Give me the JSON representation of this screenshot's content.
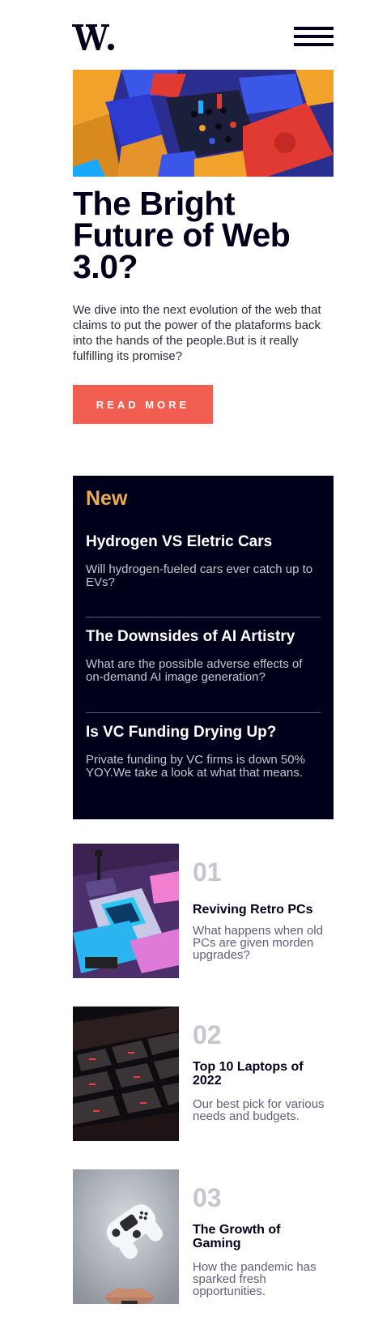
{
  "header": {
    "logo_icon": "w-logo-icon",
    "menu_icon": "hamburger-menu-icon"
  },
  "hero": {
    "image_icon": "abstract-3d-blocks-image",
    "title": "The Bright Future of Web 3.0?",
    "description": "We dive into the next evolution of the web that claims to put the power of the plataforms back into the hands of the people.But is it really fulfilling its promise?",
    "button_label": "READ MORE",
    "button_color": "#f15e50"
  },
  "new_section": {
    "heading": "New",
    "heading_color": "#e9ab53",
    "background": "#00001a",
    "items": [
      {
        "title": "Hydrogen VS Eletric Cars",
        "description": "Will hydrogen-fueled cars ever catch up to EVs?"
      },
      {
        "title": "The Downsides of AI Artistry",
        "description": "What are the possible adverse effects of on-demand AI image generation?"
      },
      {
        "title": "Is VC Funding Drying Up?",
        "description": "Private funding by VC firms is down 50% YOY.We take a look at what that means."
      }
    ]
  },
  "cards": [
    {
      "number": "01",
      "title": "Reviving Retro PCs",
      "description": "What happens when old PCs are given morden upgrades?",
      "image_icon": "retro-pc-image"
    },
    {
      "number": "02",
      "title": "Top 10 Laptops of 2022",
      "description": "Our best pick for various needs and budgets.",
      "image_icon": "laptop-keyboard-image"
    },
    {
      "number": "03",
      "title": "The Growth of Gaming",
      "description": "How the pandemic has sparked fresh opportunities.",
      "image_icon": "gamepad-image"
    }
  ]
}
